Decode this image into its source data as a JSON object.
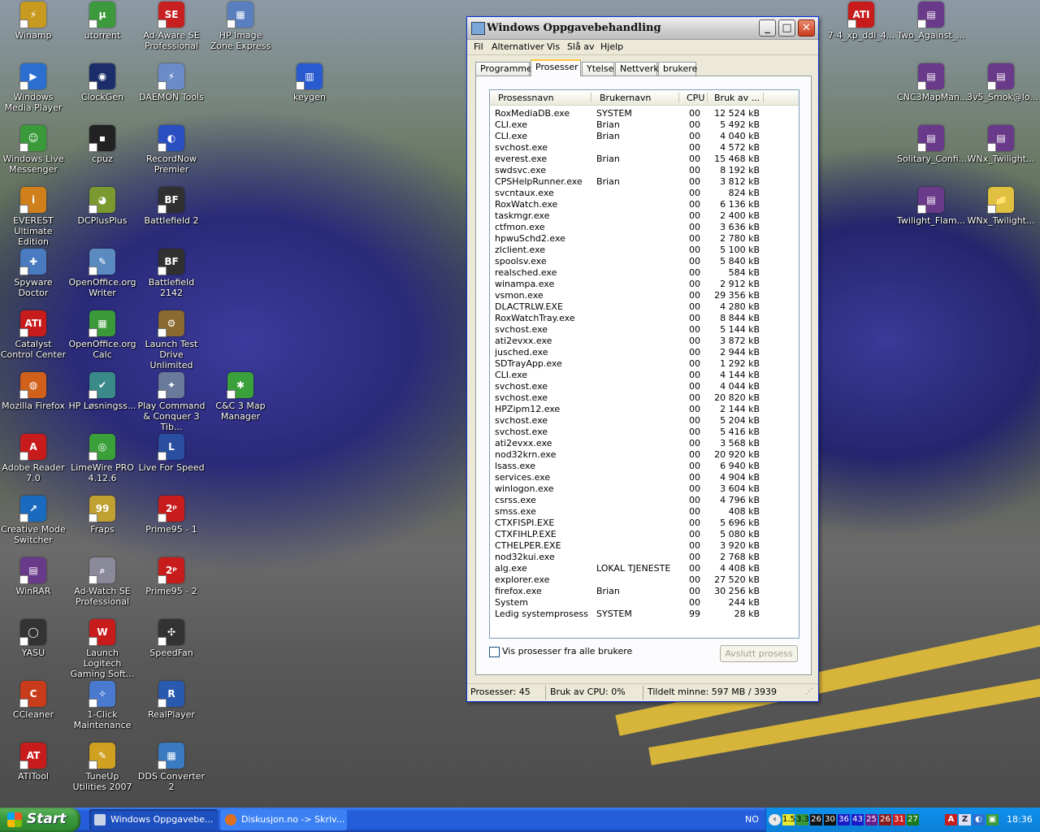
{
  "desktop": {
    "icons": [
      {
        "label": "Winamp",
        "color": "#c99a20",
        "glyph": "⚡"
      },
      {
        "label": "utorrent",
        "color": "#3c9a3c",
        "glyph": "µ"
      },
      {
        "label": "Ad-Aware SE Professional",
        "color": "#c82020",
        "glyph": "SE"
      },
      {
        "label": "HP Image Zone Express",
        "color": "#5a7fc0",
        "glyph": "▦"
      },
      {
        "label": "Windows Media Player",
        "color": "#2a6fd0",
        "glyph": "▶"
      },
      {
        "label": "ClockGen",
        "color": "#1b2e6b",
        "glyph": "◉"
      },
      {
        "label": "DAEMON Tools",
        "color": "#6a8ac8",
        "glyph": "⚡"
      },
      {
        "label": "keygen",
        "color": "#2a5ad0",
        "glyph": "▥"
      },
      {
        "label": "Windows Live Messenger",
        "color": "#3a9a3a",
        "glyph": "☺"
      },
      {
        "label": "cpuz",
        "color": "#222222",
        "glyph": "▪"
      },
      {
        "label": "RecordNow Premier",
        "color": "#2a4fc0",
        "glyph": "◐"
      },
      {
        "label": "EVEREST Ultimate Edition",
        "color": "#d0801a",
        "glyph": "i"
      },
      {
        "label": "DCPlusPlus",
        "color": "#7a9a30",
        "glyph": "◕"
      },
      {
        "label": "Battlefield 2",
        "color": "#303030",
        "glyph": "BF"
      },
      {
        "label": "Spyware Doctor",
        "color": "#4a7ac0",
        "glyph": "✚"
      },
      {
        "label": "OpenOffice.org Writer",
        "color": "#5a8ac0",
        "glyph": "✎"
      },
      {
        "label": "Battlefield 2142",
        "color": "#303030",
        "glyph": "BF"
      },
      {
        "label": "Catalyst Control Center",
        "color": "#c81c1c",
        "glyph": "ATI"
      },
      {
        "label": "OpenOffice.org Calc",
        "color": "#3a9a3a",
        "glyph": "▦"
      },
      {
        "label": "Launch Test Drive Unlimited",
        "color": "#8a6a30",
        "glyph": "⚙"
      },
      {
        "label": "Mozilla Firefox",
        "color": "#d0601a",
        "glyph": "◍"
      },
      {
        "label": "HP Løsningss...",
        "color": "#3a8a8a",
        "glyph": "✔"
      },
      {
        "label": "Play Command & Conquer 3 Tib...",
        "color": "#6a7a9a",
        "glyph": "✦"
      },
      {
        "label": "C&C 3 Map Manager",
        "color": "#3aa03a",
        "glyph": "✱"
      },
      {
        "label": "Adobe Reader 7.0",
        "color": "#c81c1c",
        "glyph": "A"
      },
      {
        "label": "LimeWire PRO 4.12.6",
        "color": "#3aa03a",
        "glyph": "◎"
      },
      {
        "label": "Live For Speed",
        "color": "#2a4fa0",
        "glyph": "L"
      },
      {
        "label": "Creative Mode Switcher",
        "color": "#1a6ac0",
        "glyph": "↗"
      },
      {
        "label": "Fraps",
        "color": "#c0a030",
        "glyph": "99"
      },
      {
        "label": "Prime95 - 1",
        "color": "#c81c1c",
        "glyph": "2ᵖ"
      },
      {
        "label": "WinRAR",
        "color": "#6a3a8a",
        "glyph": "▤"
      },
      {
        "label": "Ad-Watch SE Professional",
        "color": "#8a8a9a",
        "glyph": "⌕"
      },
      {
        "label": "Prime95 - 2",
        "color": "#c81c1c",
        "glyph": "2ᵖ"
      },
      {
        "label": "YASU",
        "color": "#333333",
        "glyph": "◯"
      },
      {
        "label": "Launch Logitech Gaming Soft...",
        "color": "#c81c1c",
        "glyph": "W"
      },
      {
        "label": "SpeedFan",
        "color": "#333333",
        "glyph": "✣"
      },
      {
        "label": "CCleaner",
        "color": "#c83c1c",
        "glyph": "C"
      },
      {
        "label": "1-Click Maintenance",
        "color": "#4a7ad0",
        "glyph": "✧"
      },
      {
        "label": "RealPlayer",
        "color": "#2a5ab0",
        "glyph": "R"
      },
      {
        "label": "ATITool",
        "color": "#c81c1c",
        "glyph": "AT"
      },
      {
        "label": "TuneUp Utilities 2007",
        "color": "#d0a020",
        "glyph": "✎"
      },
      {
        "label": "DDS Converter 2",
        "color": "#3a7ac0",
        "glyph": "▦"
      },
      {
        "label": "7-4_xp_ddl_4...",
        "color": "#c81c1c",
        "glyph": "ATI"
      },
      {
        "label": "Two_Against_...",
        "color": "#6a3a8a",
        "glyph": "▤"
      },
      {
        "label": "CNC3MapMan...",
        "color": "#6a3a8a",
        "glyph": "▤"
      },
      {
        "label": "3v5_Smok@lo...",
        "color": "#6a3a8a",
        "glyph": "▤"
      },
      {
        "label": "Solitary_Confi...",
        "color": "#6a3a8a",
        "glyph": "▤"
      },
      {
        "label": "WNx_Twilight...",
        "color": "#6a3a8a",
        "glyph": "▤"
      },
      {
        "label": "Twilight_Flam...",
        "color": "#6a3a8a",
        "glyph": "▤"
      },
      {
        "label": "WNx_Twilight...",
        "color": "#e0c040",
        "glyph": "📁"
      }
    ]
  },
  "window": {
    "title": "Windows Oppgavebehandling",
    "menu": [
      "Fil",
      "Alternativer",
      "Vis",
      "Slå av",
      "Hjelp"
    ],
    "tabs": [
      "Programmer",
      "Prosesser",
      "Ytelse",
      "Nettverk",
      "brukere"
    ],
    "active_tab": "Prosesser",
    "columns": [
      "Prosessnavn",
      "Brukernavn",
      "CPU",
      "Bruk av ..."
    ],
    "processes": [
      {
        "name": "RoxMediaDB.exe",
        "user": "SYSTEM",
        "cpu": "00",
        "mem": "12 524 kB"
      },
      {
        "name": "CLI.exe",
        "user": "Brian",
        "cpu": "00",
        "mem": "5 492 kB"
      },
      {
        "name": "CLI.exe",
        "user": "Brian",
        "cpu": "00",
        "mem": "4 040 kB"
      },
      {
        "name": "svchost.exe",
        "user": "",
        "cpu": "00",
        "mem": "4 572 kB"
      },
      {
        "name": "everest.exe",
        "user": "Brian",
        "cpu": "00",
        "mem": "15 468 kB"
      },
      {
        "name": "swdsvc.exe",
        "user": "",
        "cpu": "00",
        "mem": "8 192 kB"
      },
      {
        "name": "CPSHelpRunner.exe",
        "user": "Brian",
        "cpu": "00",
        "mem": "3 812 kB"
      },
      {
        "name": "svcntaux.exe",
        "user": "",
        "cpu": "00",
        "mem": "824 kB"
      },
      {
        "name": "RoxWatch.exe",
        "user": "",
        "cpu": "00",
        "mem": "6 136 kB"
      },
      {
        "name": "taskmgr.exe",
        "user": "",
        "cpu": "00",
        "mem": "2 400 kB"
      },
      {
        "name": "ctfmon.exe",
        "user": "",
        "cpu": "00",
        "mem": "3 636 kB"
      },
      {
        "name": "hpwuSchd2.exe",
        "user": "",
        "cpu": "00",
        "mem": "2 780 kB"
      },
      {
        "name": "zlclient.exe",
        "user": "",
        "cpu": "00",
        "mem": "5 100 kB"
      },
      {
        "name": "spoolsv.exe",
        "user": "",
        "cpu": "00",
        "mem": "5 840 kB"
      },
      {
        "name": "realsched.exe",
        "user": "",
        "cpu": "00",
        "mem": "584 kB"
      },
      {
        "name": "winampa.exe",
        "user": "",
        "cpu": "00",
        "mem": "2 912 kB"
      },
      {
        "name": "vsmon.exe",
        "user": "",
        "cpu": "00",
        "mem": "29 356 kB"
      },
      {
        "name": "DLACTRLW.EXE",
        "user": "",
        "cpu": "00",
        "mem": "4 280 kB"
      },
      {
        "name": "RoxWatchTray.exe",
        "user": "",
        "cpu": "00",
        "mem": "8 844 kB"
      },
      {
        "name": "svchost.exe",
        "user": "",
        "cpu": "00",
        "mem": "5 144 kB"
      },
      {
        "name": "ati2evxx.exe",
        "user": "",
        "cpu": "00",
        "mem": "3 872 kB"
      },
      {
        "name": "jusched.exe",
        "user": "",
        "cpu": "00",
        "mem": "2 944 kB"
      },
      {
        "name": "SDTrayApp.exe",
        "user": "",
        "cpu": "00",
        "mem": "1 292 kB"
      },
      {
        "name": "CLI.exe",
        "user": "",
        "cpu": "00",
        "mem": "4 144 kB"
      },
      {
        "name": "svchost.exe",
        "user": "",
        "cpu": "00",
        "mem": "4 044 kB"
      },
      {
        "name": "svchost.exe",
        "user": "",
        "cpu": "00",
        "mem": "20 820 kB"
      },
      {
        "name": "HPZipm12.exe",
        "user": "",
        "cpu": "00",
        "mem": "2 144 kB"
      },
      {
        "name": "svchost.exe",
        "user": "",
        "cpu": "00",
        "mem": "5 204 kB"
      },
      {
        "name": "svchost.exe",
        "user": "",
        "cpu": "00",
        "mem": "5 416 kB"
      },
      {
        "name": "ati2evxx.exe",
        "user": "",
        "cpu": "00",
        "mem": "3 568 kB"
      },
      {
        "name": "nod32krn.exe",
        "user": "",
        "cpu": "00",
        "mem": "20 920 kB"
      },
      {
        "name": "lsass.exe",
        "user": "",
        "cpu": "00",
        "mem": "6 940 kB"
      },
      {
        "name": "services.exe",
        "user": "",
        "cpu": "00",
        "mem": "4 904 kB"
      },
      {
        "name": "winlogon.exe",
        "user": "",
        "cpu": "00",
        "mem": "3 604 kB"
      },
      {
        "name": "csrss.exe",
        "user": "",
        "cpu": "00",
        "mem": "4 796 kB"
      },
      {
        "name": "smss.exe",
        "user": "",
        "cpu": "00",
        "mem": "408 kB"
      },
      {
        "name": "CTXFISPI.EXE",
        "user": "",
        "cpu": "00",
        "mem": "5 696 kB"
      },
      {
        "name": "CTXFIHLP.EXE",
        "user": "",
        "cpu": "00",
        "mem": "5 080 kB"
      },
      {
        "name": "CTHELPER.EXE",
        "user": "",
        "cpu": "00",
        "mem": "3 920 kB"
      },
      {
        "name": "nod32kui.exe",
        "user": "",
        "cpu": "00",
        "mem": "2 768 kB"
      },
      {
        "name": "alg.exe",
        "user": "LOKAL TJENESTE",
        "cpu": "00",
        "mem": "4 408 kB"
      },
      {
        "name": "explorer.exe",
        "user": "",
        "cpu": "00",
        "mem": "27 520 kB"
      },
      {
        "name": "firefox.exe",
        "user": "Brian",
        "cpu": "00",
        "mem": "30 256 kB"
      },
      {
        "name": "System",
        "user": "",
        "cpu": "00",
        "mem": "244 kB"
      },
      {
        "name": "Ledig systemprosess",
        "user": "SYSTEM",
        "cpu": "99",
        "mem": "28 kB"
      }
    ],
    "show_all_users_label": "Vis prosesser fra alle brukere",
    "end_process_label": "Avslutt prosess",
    "status": {
      "processes": "Prosesser: 45",
      "cpu": "Bruk av CPU: 0%",
      "memory": "Tildelt minne: 597 MB / 3939"
    }
  },
  "taskbar": {
    "start_label": "Start",
    "items": [
      "Windows Oppgavebe...",
      "Diskusjon.no -> Skriv..."
    ],
    "language": "NO",
    "tray_numbers": [
      "1.5",
      "3.3",
      "26",
      "30",
      "36",
      "43",
      "25",
      "26",
      "31",
      "27"
    ],
    "clock": "18:36"
  }
}
